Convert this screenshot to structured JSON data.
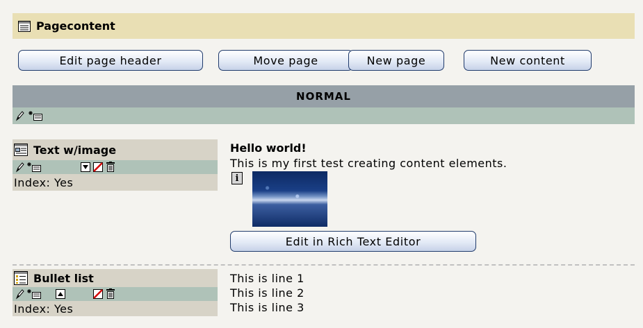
{
  "header": {
    "title": "Pagecontent"
  },
  "buttons": {
    "edit_page_header": "Edit page header",
    "move_page": "Move page",
    "new_page": "New page",
    "new_content": "New content"
  },
  "column": {
    "label": "NORMAL"
  },
  "elements": [
    {
      "type_label": "Text w/image",
      "index": "Index: Yes",
      "heading": "Hello world!",
      "body": "This is my first test creating content elements.",
      "rte_button": "Edit in Rich Text Editor"
    },
    {
      "type_label": "Bullet list",
      "index": "Index: Yes",
      "lines": [
        "This is line 1",
        "This is line 2",
        "This is line 3"
      ]
    }
  ],
  "icons": {
    "page_content": "page-content-icon",
    "edit": "pencil-icon",
    "new_record": "new-record-icon",
    "move_down": "move-down-icon",
    "move_up": "move-up-icon",
    "hide": "hide-icon",
    "delete": "trash-icon",
    "info": "info-icon"
  }
}
